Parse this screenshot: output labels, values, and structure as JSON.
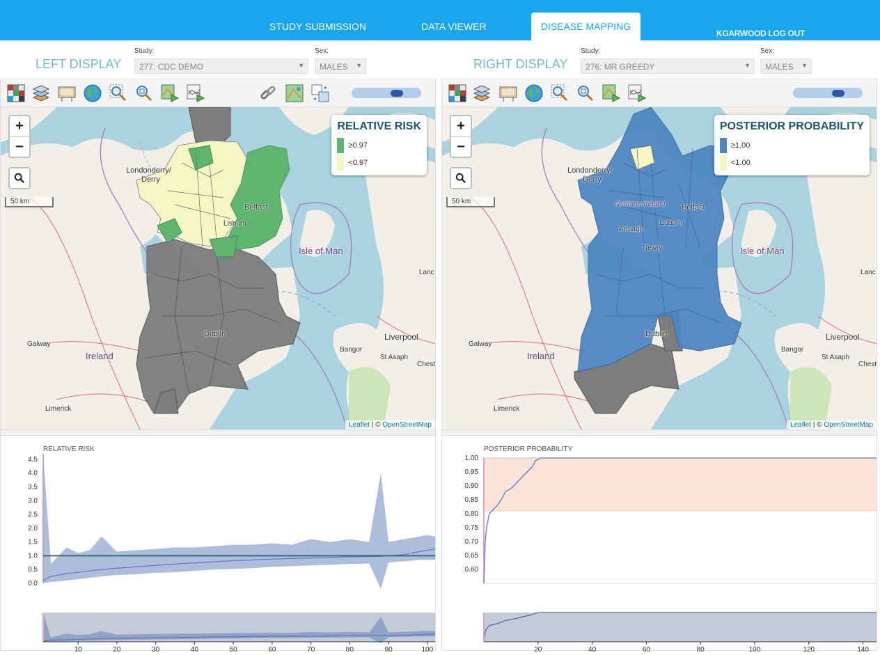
{
  "topnav": {
    "tabs": [
      "STUDY SUBMISSION",
      "DATA VIEWER",
      "DISEASE MAPPING"
    ],
    "active_tab": "DISEASE MAPPING",
    "logout": "KGARWOOD LOG OUT"
  },
  "left": {
    "title": "LEFT DISPLAY",
    "study_label": "Study:",
    "study_value": "277: CDC DEMO",
    "sex_label": "Sex:",
    "sex_value": "MALES",
    "legend_title": "RELATIVE RISK",
    "legend_items": [
      {
        "label": "≥0.97",
        "color": "#5fb46f"
      },
      {
        "label": "<0.97",
        "color": "#f4f7c4"
      }
    ],
    "chart_title": "RELATIVE RISK"
  },
  "right": {
    "title": "RIGHT DISPLAY",
    "study_label": "Study:",
    "study_value": "276: MR GREEDY",
    "sex_label": "Sex:",
    "sex_value": "MALES",
    "legend_title": "POSTERIOR PROBABILITY",
    "legend_items": [
      {
        "label": "≥1.00",
        "color": "#4e87c2"
      },
      {
        "label": "<1.00",
        "color": "#f4f7c4"
      }
    ],
    "chart_title": "POSTERIOR PROBABILITY"
  },
  "map": {
    "zoom_in": "+",
    "zoom_out": "−",
    "scale_label": "50 km",
    "attribution_leaflet": "Leaflet",
    "attribution_sep": " | © ",
    "attribution_osm": "OpenStreetMap",
    "places": [
      "Londonderry/",
      "Derry",
      "Northern Ireland",
      "Belfast",
      "Lisburn",
      "Armagh",
      "Newry",
      "Isle of Man",
      "Dublin",
      "Galway",
      "Ireland",
      "Limerick",
      "Bangor",
      "St Asaph",
      "Liverpool",
      "Chest",
      "Lanc"
    ]
  },
  "colors": {
    "brand": "#1aa6ee",
    "grey_area": "#7d7d7d",
    "green_area": "#5fb46f",
    "yellow_area": "#f4f7c4",
    "blue_area": "#4e87c2",
    "chart_band": "#9fb3d6",
    "chart_line": "#6674c8",
    "chart_ref": "#2f6f77",
    "pp_band": "#fde4d8"
  },
  "chart_data": [
    {
      "type": "area",
      "title": "RELATIVE RISK",
      "ylim": [
        0,
        4.7
      ],
      "yticks": [
        0.0,
        0.5,
        1.0,
        1.5,
        2.0,
        2.5,
        3.0,
        3.5,
        4.0,
        4.5
      ],
      "xticks": [
        10,
        20,
        30,
        40,
        50,
        60,
        70,
        80,
        90,
        100
      ],
      "xlim": [
        1,
        102
      ],
      "reference_line": 1.0,
      "series": [
        {
          "values": [
            0.1,
            0.25,
            0.35,
            0.4,
            0.45,
            0.5,
            0.55,
            0.6,
            0.65,
            0.7,
            0.74,
            0.78,
            0.82,
            0.85,
            0.88,
            0.9,
            0.92,
            0.94,
            0.96,
            0.97,
            0.98,
            1.0,
            1.02,
            1.05,
            1.1,
            1.15,
            1.2,
            1.25
          ]
        },
        {
          "values": [
            0.0,
            0.05,
            0.1,
            0.15,
            0.2,
            0.25,
            0.3,
            0.33,
            0.38,
            0.4,
            0.45,
            0.5,
            0.52,
            0.55,
            0.6,
            0.62,
            0.65,
            0.67,
            0.7,
            0.72,
            -0.2,
            0.75,
            0.78,
            0.8,
            0.82,
            0.85,
            0.85,
            0.85
          ]
        },
        {
          "values": [
            4.7,
            0.7,
            1.3,
            1.1,
            1.2,
            1.7,
            1.15,
            1.2,
            1.25,
            1.3,
            1.3,
            1.35,
            1.4,
            1.4,
            1.45,
            1.4,
            1.6,
            1.5,
            1.6,
            1.5,
            4.0,
            1.5,
            1.55,
            1.6,
            1.65,
            1.7,
            1.75,
            1.7
          ]
        }
      ],
      "x": [
        1,
        3,
        7,
        10,
        13,
        16,
        20,
        25,
        30,
        35,
        40,
        45,
        50,
        55,
        60,
        65,
        70,
        75,
        80,
        85,
        88,
        90,
        92,
        94,
        96,
        98,
        100,
        102
      ]
    },
    {
      "type": "line",
      "title": "POSTERIOR PROBABILITY",
      "ylim": [
        0.55,
        1.0
      ],
      "yticks": [
        0.6,
        0.65,
        0.7,
        0.75,
        0.8,
        0.85,
        0.9,
        0.95,
        1.0
      ],
      "xticks": [
        20,
        40,
        60,
        80,
        100,
        120,
        140
      ],
      "xlim": [
        0,
        145
      ],
      "band": [
        0.81,
        1.0
      ],
      "x": [
        0,
        0.5,
        1,
        2,
        3,
        5,
        7,
        8,
        10,
        14,
        16,
        18,
        19,
        21,
        25,
        145
      ],
      "values": [
        0.55,
        0.7,
        0.75,
        0.8,
        0.81,
        0.83,
        0.86,
        0.88,
        0.89,
        0.93,
        0.95,
        0.97,
        0.99,
        1.0,
        1.0,
        1.0
      ]
    }
  ]
}
